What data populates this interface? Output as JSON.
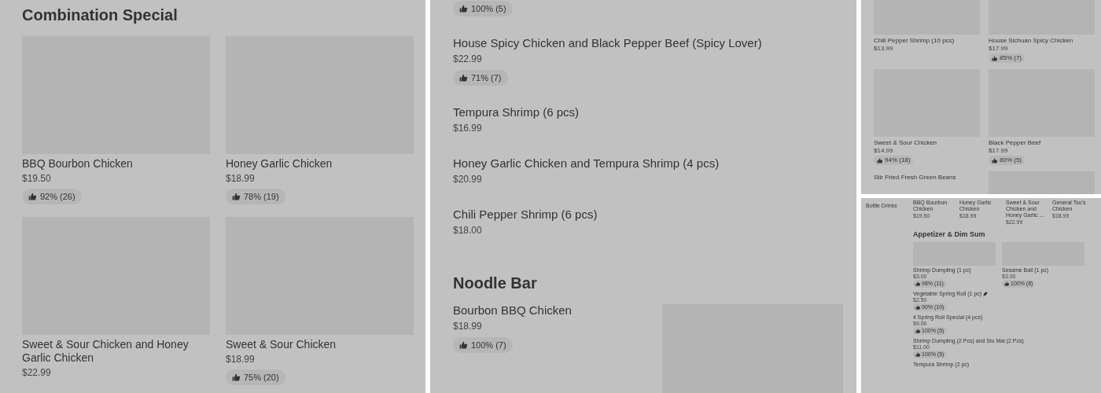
{
  "panels": [
    {
      "kind": "large_grid",
      "sections": [
        {
          "title": "Combination Special",
          "items": [
            {
              "name": "BBQ Bourbon Chicken",
              "price": "$19.50",
              "rating": "92% (26)",
              "photo": true
            },
            {
              "name": "Honey Garlic Chicken",
              "price": "$18.99",
              "rating": "78% (19)",
              "photo": true
            },
            {
              "name": "Sweet & Sour Chicken and Honey Garlic Chicken",
              "price": "$22.99",
              "photo": true
            },
            {
              "name": "Sweet & Sour Chicken",
              "price": "$18.99",
              "rating": "75% (20)",
              "photo": true
            }
          ]
        }
      ]
    },
    {
      "kind": "large_list",
      "sections": [
        {
          "items": [
            {
              "rating": "100% (5)"
            },
            {
              "name": "House Spicy Chicken and Black Pepper Beef (Spicy Lover)",
              "price": "$22.99",
              "rating": "71% (7)"
            },
            {
              "name": "Tempura Shrimp (6 pcs)",
              "price": "$16.99"
            },
            {
              "name": "Honey Garlic Chicken and Tempura Shrimp (4 pcs)",
              "price": "$20.99"
            },
            {
              "name": "Chili Pepper Shrimp (6 pcs)",
              "price": "$18.00"
            }
          ]
        },
        {
          "title": "Noodle Bar",
          "items": [
            {
              "name": "Bourbon BBQ Chicken",
              "price": "$18.99",
              "rating": "100% (7)",
              "photo": true
            }
          ]
        }
      ]
    },
    {
      "kind": "small_grid",
      "sections": [
        {
          "items": [
            {
              "name": "Chili Pepper Shrimp (10 pcs)",
              "price": "$13.99",
              "photo": true
            },
            {
              "name": "House Sichuan Spicy Chicken",
              "price": "$17.99",
              "rating": "85% (7)",
              "photo": true
            },
            {
              "name": "Sweet & Sour Chicken",
              "price": "$14.99",
              "rating": "94% (18)",
              "photo": true
            },
            {
              "name": "Black Pepper Beef",
              "price": "$17.99",
              "rating": "80% (5)",
              "photo": true
            },
            {
              "name": "Stir Fried Fresh Green Beans"
            },
            {
              "photo": true
            }
          ]
        }
      ]
    },
    {
      "kind": "tiny_menu",
      "sidebar": [
        "Bottle Drinks"
      ],
      "strip": [
        {
          "name": "BBQ Bourbon Chicken",
          "price": "$19.50"
        },
        {
          "name": "Honey Garlic Chicken",
          "price": "$18.99"
        },
        {
          "name": "Sweet & Sour Chicken and Honey Garlic ...",
          "price": "$22.99"
        },
        {
          "name": "General Tso's Chicken",
          "price": "$18.99"
        }
      ],
      "sections": [
        {
          "title": "Appetizer & Dim Sum",
          "items": [
            {
              "name": "Shrimp Dumpling (1 pc)",
              "price": "$3.00",
              "rating": "98% (11)",
              "photo": true
            },
            {
              "name": "Sesame Ball (1 pc)",
              "price": "$3.00",
              "rating": "100% (8)",
              "photo": true
            },
            {
              "name": "Vegetable Spring Roll (1 pc)",
              "price": "$2.50",
              "rating": "90% (10)",
              "leaf": true
            },
            {
              "name": "4 Spring Roll Special (4 pcs)",
              "price": "$9.00",
              "rating": "100% (5)"
            },
            {
              "name": "Shrimp Dumpling (2 Pcs) and Siu Mai (2 Pcs)",
              "price": "$11.00",
              "rating": "100% (5)"
            },
            {
              "name": "Tempura Shrimp (2 pc)"
            }
          ]
        }
      ]
    }
  ]
}
